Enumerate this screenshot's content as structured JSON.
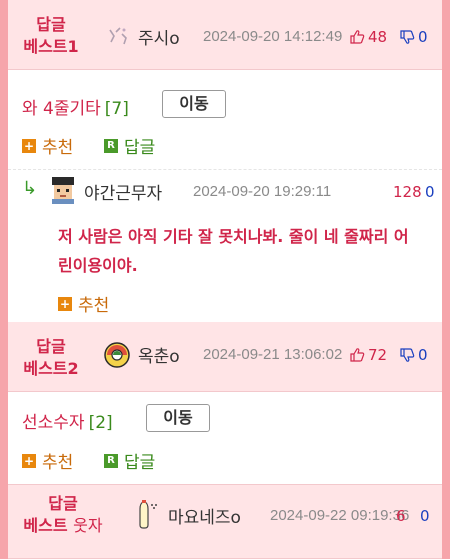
{
  "best1": {
    "rank_line1": "답글",
    "rank_line2": "베스트1",
    "nick": "주시o",
    "date": "2024-09-20 14:12:49",
    "up": "48",
    "down": "0",
    "body": "와 4줄기타",
    "count": "[7]",
    "move": "이동",
    "recommend": "추천",
    "reply": "답글"
  },
  "reply1": {
    "nick": "야간근무자",
    "date": "2024-09-20 19:29:11",
    "up": "128",
    "down": "0",
    "text": "저 사람은 아직 기타 잘 못치나봐. 줄이 네 줄짜리 어린이용이야.",
    "recommend": "추천"
  },
  "best2": {
    "rank_line1": "답글",
    "rank_line2": "베스트2",
    "nick": "옥춘o",
    "date": "2024-09-21 13:06:02",
    "up": "72",
    "down": "0",
    "body": "선소수자",
    "count": "[2]",
    "move": "이동",
    "recommend": "추천",
    "reply": "답글"
  },
  "best3": {
    "rank_line1": "답글",
    "rank_line2": "베스트",
    "rank_suffix": "웃자",
    "nick": "마요네즈o",
    "date": "2024-09-22 09:19:36",
    "up": "6",
    "down": "0"
  },
  "colors": {
    "accent": "#d0254a",
    "frame": "#f6a5ab",
    "header_bg": "#ffe4e6",
    "green": "#3a8a1c",
    "orange": "#e8870d",
    "blue": "#1a3fbf"
  }
}
